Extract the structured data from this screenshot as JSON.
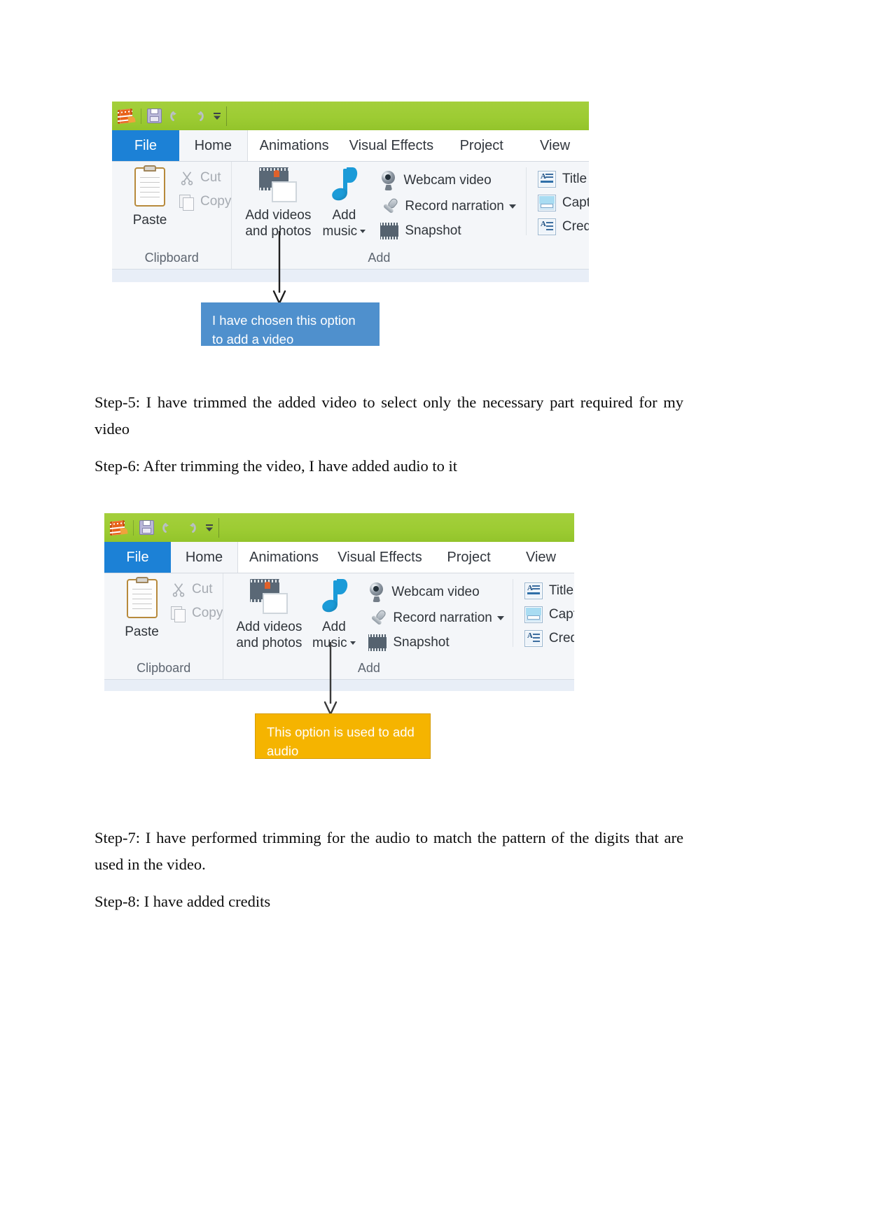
{
  "document": {
    "paragraphs": [
      {
        "id": "step5",
        "text": "Step-5: I have trimmed the added video to select only the necessary part required for my video"
      },
      {
        "id": "step6",
        "text": "Step-6: After trimming the video, I have added audio to it"
      },
      {
        "id": "step7",
        "text": "Step-7:  I have performed trimming for the audio to match the pattern of the digits that are used in the video."
      },
      {
        "id": "step8",
        "text": "Step-8: I have added credits"
      }
    ]
  },
  "ribbon": {
    "quick_access": {
      "app_icon": "movie-maker-icon",
      "buttons": [
        {
          "name": "save-icon",
          "label": "Save"
        },
        {
          "name": "undo-icon",
          "label": "Undo"
        },
        {
          "name": "redo-icon",
          "label": "Redo"
        },
        {
          "name": "customize-quick-access-icon",
          "label": "Customize Quick Access Toolbar"
        }
      ]
    },
    "tabs": [
      {
        "id": "file",
        "label": "File",
        "state": "file"
      },
      {
        "id": "home",
        "label": "Home",
        "state": "active"
      },
      {
        "id": "animations",
        "label": "Animations",
        "state": "normal"
      },
      {
        "id": "visual-effects",
        "label": "Visual Effects",
        "state": "normal"
      },
      {
        "id": "project",
        "label": "Project",
        "state": "normal"
      },
      {
        "id": "view",
        "label": "View",
        "state": "normal"
      }
    ],
    "groups": [
      {
        "id": "clipboard",
        "label": "Clipboard",
        "big_buttons": [
          {
            "id": "paste",
            "label": "Paste",
            "icon": "clipboard-icon"
          }
        ],
        "small_buttons": [
          {
            "id": "cut",
            "label": "Cut",
            "icon": "scissors-icon",
            "enabled": false
          },
          {
            "id": "copy",
            "label": "Copy",
            "icon": "copy-icon",
            "enabled": false
          }
        ]
      },
      {
        "id": "add",
        "label": "Add",
        "big_buttons": [
          {
            "id": "add-videos-and-photos",
            "label_line1": "Add videos",
            "label_line2": "and photos",
            "icon": "film-photo-icon"
          },
          {
            "id": "add-music",
            "label_line1": "Add",
            "label_line2": "music",
            "icon": "music-note-icon",
            "dropdown": true
          }
        ],
        "small_buttons": [
          {
            "id": "webcam-video",
            "label": "Webcam video",
            "icon": "webcam-icon",
            "dropdown": false
          },
          {
            "id": "record-narration",
            "label": "Record narration",
            "icon": "microphone-icon",
            "dropdown": true
          },
          {
            "id": "snapshot",
            "label": "Snapshot",
            "icon": "snapshot-icon",
            "dropdown": false
          }
        ],
        "text_buttons": [
          {
            "id": "title",
            "label": "Title",
            "icon": "title-icon",
            "dropdown": false
          },
          {
            "id": "caption",
            "label": "Caption",
            "icon": "caption-icon",
            "dropdown": false
          },
          {
            "id": "credits",
            "label": "Credits",
            "icon": "credits-icon",
            "dropdown": true
          }
        ]
      }
    ]
  },
  "annotations": [
    {
      "id": "callout-video",
      "text": "I have chosen this option to add a video",
      "color": "#4f90cd",
      "points_to": "add-videos-and-photos"
    },
    {
      "id": "callout-audio",
      "text": "This option is used to add audio",
      "color": "#f5b400",
      "points_to": "add-music"
    }
  ],
  "colors": {
    "toolbar_green": "#9dcc33",
    "file_tab_blue": "#1c81d6",
    "ribbon_bg": "#f4f6f9",
    "callout_blue": "#4f90cd",
    "callout_orange": "#f5b400"
  }
}
